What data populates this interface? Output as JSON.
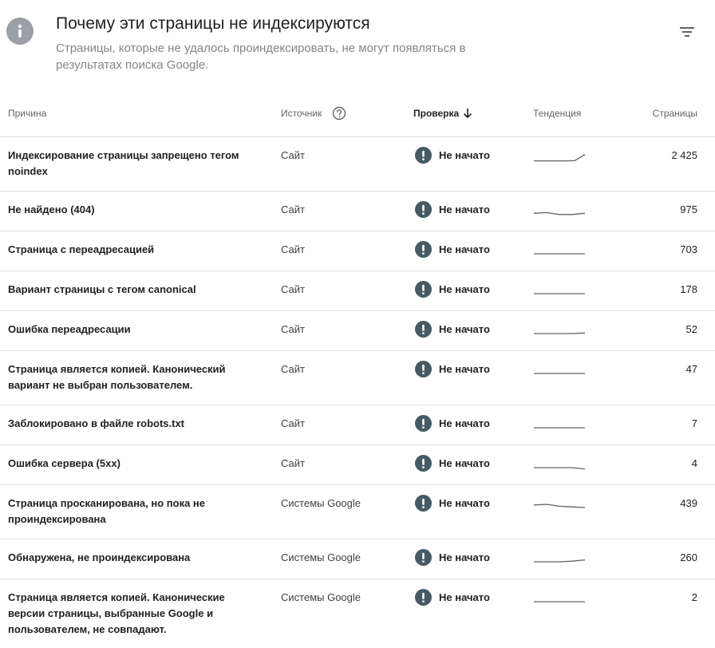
{
  "header": {
    "icon": "info-icon",
    "title": "Почему эти страницы не индексируются",
    "subtitle": "Страницы, которые не удалось проиндексировать, не могут появляться в результатах поиска Google.",
    "filter_icon": "filter-icon"
  },
  "table": {
    "columns": {
      "reason": "Причина",
      "source": "Источник",
      "check": "Проверка",
      "trend": "Тенденция",
      "pages": "Страницы"
    },
    "status_color": "#455a64",
    "rows": [
      {
        "reason": "Индексирование страницы запрещено тегом noindex",
        "source": "Сайт",
        "status": "Не начато",
        "pages": "2 425",
        "trend": [
          0.3,
          0.3,
          0.3,
          0.3,
          0.32,
          0.8
        ]
      },
      {
        "reason": "Не найдено (404)",
        "source": "Сайт",
        "status": "Не начато",
        "pages": "975",
        "trend": [
          0.45,
          0.5,
          0.35,
          0.35,
          0.45
        ]
      },
      {
        "reason": "Страница с переадресацией",
        "source": "Сайт",
        "status": "Не начато",
        "pages": "703",
        "trend": [
          0.4,
          0.4,
          0.4,
          0.4,
          0.4
        ]
      },
      {
        "reason": "Вариант страницы с тегом canonical",
        "source": "Сайт",
        "status": "Не начато",
        "pages": "178",
        "trend": [
          0.4,
          0.4,
          0.4,
          0.4,
          0.4
        ]
      },
      {
        "reason": "Ошибка переадресации",
        "source": "Сайт",
        "status": "Не начато",
        "pages": "52",
        "trend": [
          0.4,
          0.4,
          0.4,
          0.4,
          0.45
        ]
      },
      {
        "reason": "Страница является копией. Канонический вариант не выбран пользователем.",
        "source": "Сайт",
        "status": "Не начато",
        "pages": "47",
        "trend": [
          0.4,
          0.4,
          0.4,
          0.4,
          0.4
        ]
      },
      {
        "reason": "Заблокировано в файле robots.txt",
        "source": "Сайт",
        "status": "Не начато",
        "pages": "7",
        "trend": [
          0.4,
          0.4,
          0.4,
          0.4,
          0.4
        ]
      },
      {
        "reason": "Ошибка сервера (5xx)",
        "source": "Сайт",
        "status": "Не начато",
        "pages": "4",
        "trend": [
          0.4,
          0.4,
          0.4,
          0.4,
          0.3
        ]
      },
      {
        "reason": "Страница просканирована, но пока не проиндексирована",
        "source": "Системы Google",
        "status": "Не начато",
        "pages": "439",
        "trend": [
          0.6,
          0.65,
          0.5,
          0.45,
          0.4
        ]
      },
      {
        "reason": "Обнаружена, не проиндексирована",
        "source": "Системы Google",
        "status": "Не начато",
        "pages": "260",
        "trend": [
          0.4,
          0.4,
          0.4,
          0.45,
          0.55
        ]
      },
      {
        "reason": "Страница является копией. Канонические версии страницы, выбранные Google и пользователем, не совпадают.",
        "source": "Системы Google",
        "status": "Не начато",
        "pages": "2",
        "trend": [
          0.4,
          0.4,
          0.4,
          0.4,
          0.4
        ]
      }
    ]
  }
}
